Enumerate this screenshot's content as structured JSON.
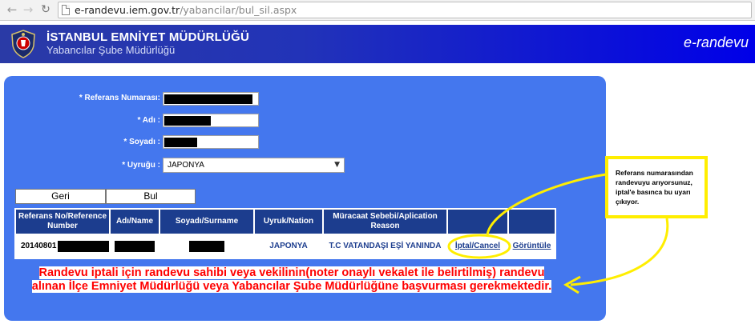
{
  "browser": {
    "url_host": "e-randevu.iem.gov.tr",
    "url_path": "/yabancilar/bul_sil.aspx",
    "icons": {
      "back": "back-arrow-icon",
      "forward": "forward-arrow-icon",
      "reload": "reload-icon",
      "page": "page-icon"
    }
  },
  "header": {
    "title": "İSTANBUL EMNİYET MÜDÜRLÜĞÜ",
    "subtitle": "Yabancılar Şube Müdürlüğü",
    "app_name": "e-randevu",
    "colors": {
      "gradient_start": "#2a3aa6",
      "gradient_end": "#0000e8"
    }
  },
  "form": {
    "panel_color": "#4477ee",
    "fields": {
      "referans": {
        "label": "* Referans Numarası:"
      },
      "adi": {
        "label": "* Adı :"
      },
      "soyadi": {
        "label": "* Soyadı :"
      },
      "uyrugu": {
        "label": "* Uyruğu :",
        "selected": "JAPONYA"
      }
    },
    "buttons": {
      "back": "Geri",
      "search": "Bul"
    }
  },
  "table": {
    "header_color": "#1c3d8e",
    "columns": [
      "Referans No/Reference Number",
      "Adı/Name",
      "Soyadı/Surname",
      "Uyruk/Nation",
      "Müracaat Sebebi/Aplication Reason",
      "",
      ""
    ],
    "row": {
      "ref_prefix": "20140801",
      "nation": "JAPONYA",
      "reason": "T.C VATANDAŞI EŞİ YANINDA",
      "cancel_link": "İptal/Cancel",
      "view_link": "Görüntüle"
    }
  },
  "notice": {
    "text": "Randevu iptali için randevu sahibi veya vekilinin(noter onaylı vekalet ile belirtilmiş) randevu alınan İlçe Emniyet Müdürlüğü veya Yabancılar Şube Müdürlüğüne başvurması gerekmektedir.",
    "color": "#ff0000"
  },
  "annotation": {
    "text": "Referans numarasından randevuyu arıyorsunuz, iptal'e basınca bu uyarı çıkıyor.",
    "color": "#ffee00"
  }
}
